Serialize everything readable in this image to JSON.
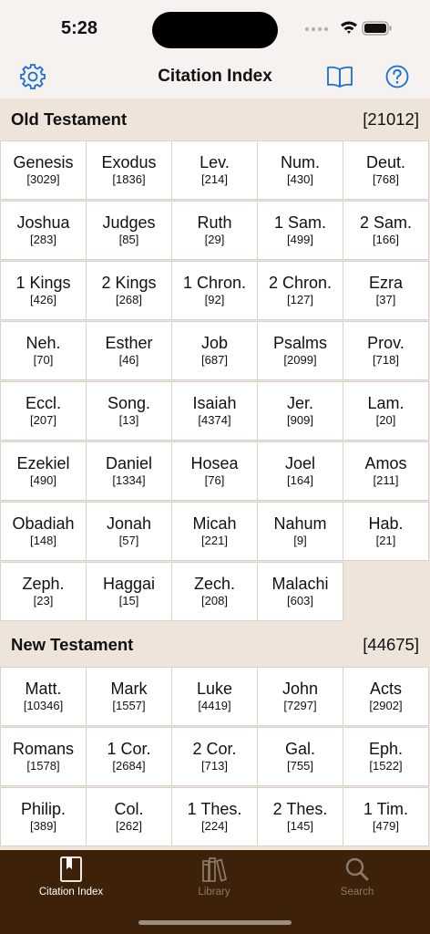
{
  "status": {
    "time": "5:28"
  },
  "nav": {
    "title": "Citation Index",
    "settings_icon": "gear-icon",
    "library_icon": "book-open-icon",
    "help_icon": "question-circle-icon"
  },
  "old_testament": {
    "title": "Old Testament",
    "count": "[21012]",
    "books": [
      {
        "name": "Genesis",
        "count": "[3029]"
      },
      {
        "name": "Exodus",
        "count": "[1836]"
      },
      {
        "name": "Lev.",
        "count": "[214]"
      },
      {
        "name": "Num.",
        "count": "[430]"
      },
      {
        "name": "Deut.",
        "count": "[768]"
      },
      {
        "name": "Joshua",
        "count": "[283]"
      },
      {
        "name": "Judges",
        "count": "[85]"
      },
      {
        "name": "Ruth",
        "count": "[29]"
      },
      {
        "name": "1 Sam.",
        "count": "[499]"
      },
      {
        "name": "2 Sam.",
        "count": "[166]"
      },
      {
        "name": "1 Kings",
        "count": "[426]"
      },
      {
        "name": "2 Kings",
        "count": "[268]"
      },
      {
        "name": "1 Chron.",
        "count": "[92]"
      },
      {
        "name": "2 Chron.",
        "count": "[127]"
      },
      {
        "name": "Ezra",
        "count": "[37]"
      },
      {
        "name": "Neh.",
        "count": "[70]"
      },
      {
        "name": "Esther",
        "count": "[46]"
      },
      {
        "name": "Job",
        "count": "[687]"
      },
      {
        "name": "Psalms",
        "count": "[2099]"
      },
      {
        "name": "Prov.",
        "count": "[718]"
      },
      {
        "name": "Eccl.",
        "count": "[207]"
      },
      {
        "name": "Song.",
        "count": "[13]"
      },
      {
        "name": "Isaiah",
        "count": "[4374]"
      },
      {
        "name": "Jer.",
        "count": "[909]"
      },
      {
        "name": "Lam.",
        "count": "[20]"
      },
      {
        "name": "Ezekiel",
        "count": "[490]"
      },
      {
        "name": "Daniel",
        "count": "[1334]"
      },
      {
        "name": "Hosea",
        "count": "[76]"
      },
      {
        "name": "Joel",
        "count": "[164]"
      },
      {
        "name": "Amos",
        "count": "[211]"
      },
      {
        "name": "Obadiah",
        "count": "[148]"
      },
      {
        "name": "Jonah",
        "count": "[57]"
      },
      {
        "name": "Micah",
        "count": "[221]"
      },
      {
        "name": "Nahum",
        "count": "[9]"
      },
      {
        "name": "Hab.",
        "count": "[21]"
      },
      {
        "name": "Zeph.",
        "count": "[23]"
      },
      {
        "name": "Haggai",
        "count": "[15]"
      },
      {
        "name": "Zech.",
        "count": "[208]"
      },
      {
        "name": "Malachi",
        "count": "[603]"
      }
    ]
  },
  "new_testament": {
    "title": "New Testament",
    "count": "[44675]",
    "books": [
      {
        "name": "Matt.",
        "count": "[10346]"
      },
      {
        "name": "Mark",
        "count": "[1557]"
      },
      {
        "name": "Luke",
        "count": "[4419]"
      },
      {
        "name": "John",
        "count": "[7297]"
      },
      {
        "name": "Acts",
        "count": "[2902]"
      },
      {
        "name": "Romans",
        "count": "[1578]"
      },
      {
        "name": "1 Cor.",
        "count": "[2684]"
      },
      {
        "name": "2 Cor.",
        "count": "[713]"
      },
      {
        "name": "Gal.",
        "count": "[755]"
      },
      {
        "name": "Eph.",
        "count": "[1522]"
      },
      {
        "name": "Philip.",
        "count": "[389]"
      },
      {
        "name": "Col.",
        "count": "[262]"
      },
      {
        "name": "1 Thes.",
        "count": "[224]"
      },
      {
        "name": "2 Thes.",
        "count": "[145]"
      },
      {
        "name": "1 Tim.",
        "count": "[479]"
      }
    ]
  },
  "tabs": [
    {
      "label": "Citation Index",
      "icon": "bookmark-book-icon",
      "active": true
    },
    {
      "label": "Library",
      "icon": "books-icon",
      "active": false
    },
    {
      "label": "Search",
      "icon": "search-icon",
      "active": false
    }
  ],
  "colors": {
    "accent": "#1a6fd6",
    "tab_bar": "#3d2108",
    "section_bg": "#efe4da"
  }
}
